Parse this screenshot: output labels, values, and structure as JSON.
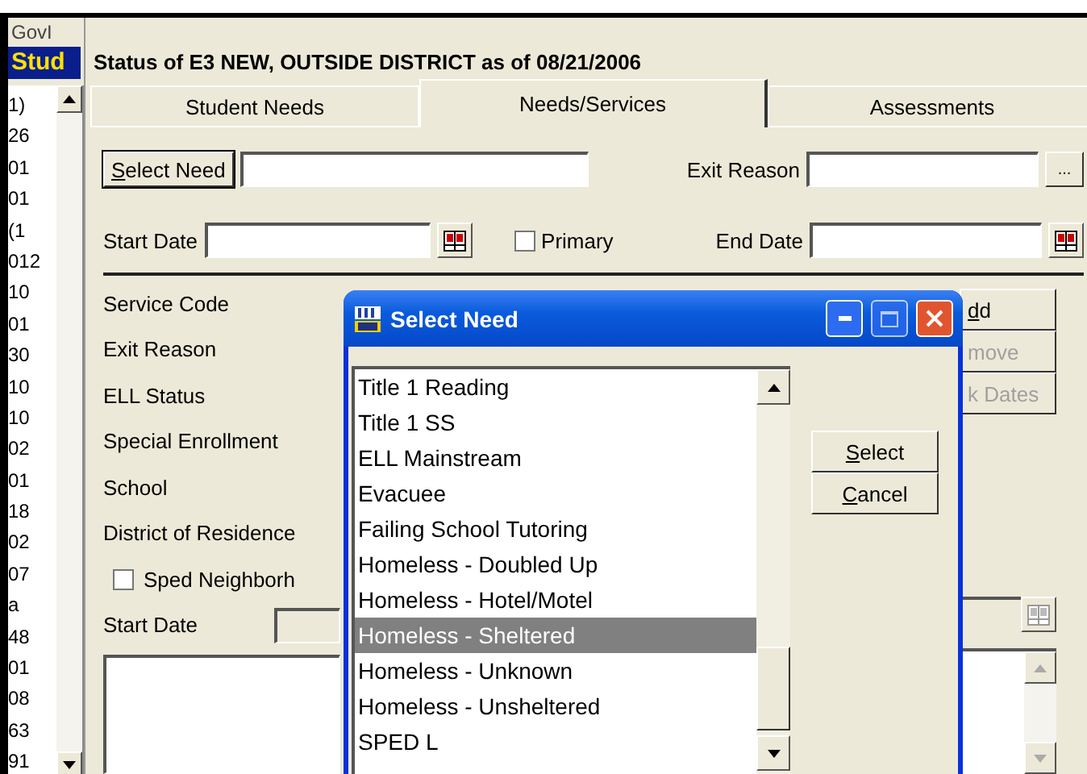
{
  "left_panel": {
    "header": "GovI",
    "title": "Stud",
    "items": [
      "1)",
      "26",
      "01",
      "01",
      "(1",
      "012",
      "10",
      "01",
      "30",
      "10",
      "10",
      "02",
      "01",
      "18",
      "02",
      "07",
      "a",
      "48",
      "01",
      "08",
      "63",
      "91"
    ]
  },
  "status_title": "Status of E3 NEW, OUTSIDE DISTRICT as of 08/21/2006",
  "tabs": [
    {
      "label": "Student Needs",
      "selected": false
    },
    {
      "label": "Needs/Services",
      "selected": true
    },
    {
      "label": "Assessments",
      "selected": false
    }
  ],
  "need": {
    "button": "Select Need",
    "exit_reason_label": "Exit Reason",
    "browse_button": "..."
  },
  "dates": {
    "start_label": "Start Date",
    "primary_label": "Primary",
    "primary_checked": false,
    "end_label": "End Date"
  },
  "service_labels": [
    "Service Code",
    "Exit Reason",
    "ELL Status",
    "Special Enrollment",
    "School",
    "District of Residence"
  ],
  "sped": {
    "label": "Sped Neighborh",
    "checked": false
  },
  "service_start_label": "Start Date",
  "side_buttons": [
    {
      "label": "dd",
      "disabled": false
    },
    {
      "label": "move",
      "disabled": true
    },
    {
      "label": "k Dates",
      "disabled": true
    }
  ],
  "dialog": {
    "title": "Select Need",
    "items": [
      {
        "label": "Title 1 Reading",
        "selected": false
      },
      {
        "label": "Title 1 SS",
        "selected": false
      },
      {
        "label": "ELL Mainstream",
        "selected": false
      },
      {
        "label": "Evacuee",
        "selected": false
      },
      {
        "label": "Failing School Tutoring",
        "selected": false
      },
      {
        "label": "Homeless - Doubled Up",
        "selected": false
      },
      {
        "label": "Homeless - Hotel/Motel",
        "selected": false
      },
      {
        "label": "Homeless - Sheltered",
        "selected": true
      },
      {
        "label": "Homeless - Unknown",
        "selected": false
      },
      {
        "label": "Homeless - Unsheltered",
        "selected": false
      },
      {
        "label": "SPED L",
        "selected": false
      }
    ],
    "buttons": [
      "Select",
      "Cancel"
    ]
  }
}
